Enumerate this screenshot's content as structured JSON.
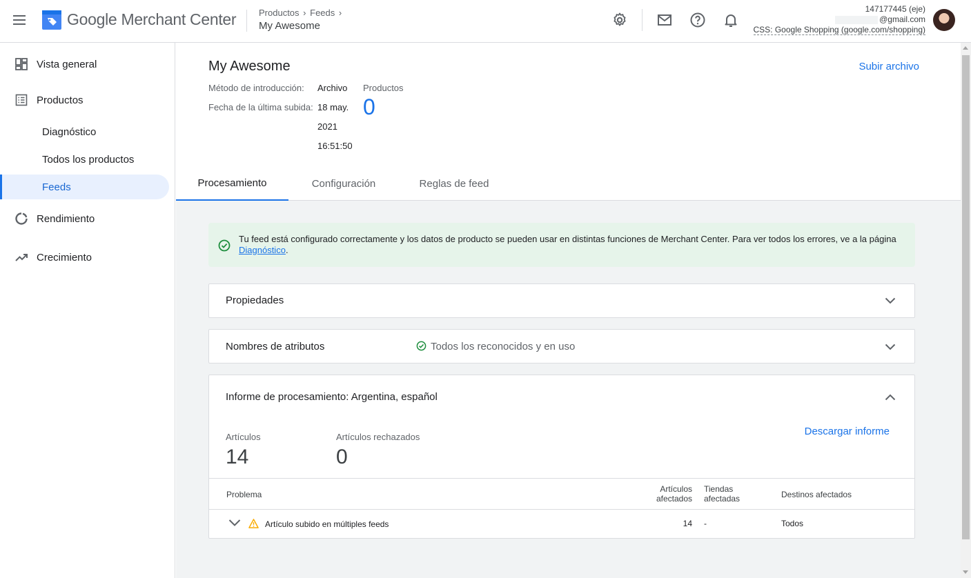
{
  "header": {
    "brand": "Google Merchant Center",
    "breadcrumbs": [
      "Productos",
      "Feeds"
    ],
    "page_title": "My Awesome",
    "account_id": "147177445 (eje)",
    "account_email": "@gmail.com",
    "account_css": "CSS: Google Shopping (google.com/shopping)",
    "icons": [
      "menu-icon",
      "gear-icon",
      "mail-icon",
      "help-icon",
      "bell-icon"
    ]
  },
  "sidebar": {
    "items": [
      {
        "label": "Vista general",
        "icon": "dashboard-icon"
      },
      {
        "label": "Productos",
        "icon": "list-icon"
      },
      {
        "label": "Diagnóstico"
      },
      {
        "label": "Todos los productos"
      },
      {
        "label": "Feeds",
        "active": true
      },
      {
        "label": "Rendimiento",
        "icon": "donut-icon"
      },
      {
        "label": "Crecimiento",
        "icon": "trending-up-icon"
      }
    ]
  },
  "feed": {
    "title": "My Awesome",
    "upload_label": "Subir archivo",
    "method_label": "Método de introducción:",
    "method_value": "Archivo",
    "last_upload_label": "Fecha de la última subida:",
    "last_upload_line1": "18 may.",
    "last_upload_line2": "2021",
    "last_upload_line3": "16:51:50",
    "products_label": "Productos",
    "products_value": "0"
  },
  "tabs": [
    {
      "label": "Procesamiento",
      "active": true
    },
    {
      "label": "Configuración"
    },
    {
      "label": "Reglas de feed"
    }
  ],
  "alert": {
    "text": "Tu feed está configurado correctamente y los datos de producto se pueden usar en distintas funciones de Merchant Center. Para ver todos los errores, ve a la página ",
    "link": "Diagnóstico",
    "end": ".",
    "color": "#e6f4ea"
  },
  "cards": {
    "properties_title": "Propiedades",
    "attributes_title": "Nombres de atributos",
    "attributes_status": "Todos los reconocidos y en uso",
    "report_title": "Informe de procesamiento: Argentina, español"
  },
  "report": {
    "items_label": "Artículos",
    "items_value": "14",
    "rejected_label": "Artículos rechazados",
    "rejected_value": "0",
    "download_label": "Descargar informe",
    "columns": {
      "problem": "Problema",
      "affected_items_1": "Artículos",
      "affected_items_2": "afectados",
      "affected_stores_1": "Tiendas",
      "affected_stores_2": "afectadas",
      "affected_destinations": "Destinos afectados"
    },
    "rows": [
      {
        "problem": "Artículo subido en múltiples feeds",
        "items": "14",
        "stores": "-",
        "destinations": "Todos"
      }
    ]
  },
  "colors": {
    "accent": "#1a73e8",
    "success": "#1e8e3e",
    "warning": "#f9ab00"
  }
}
